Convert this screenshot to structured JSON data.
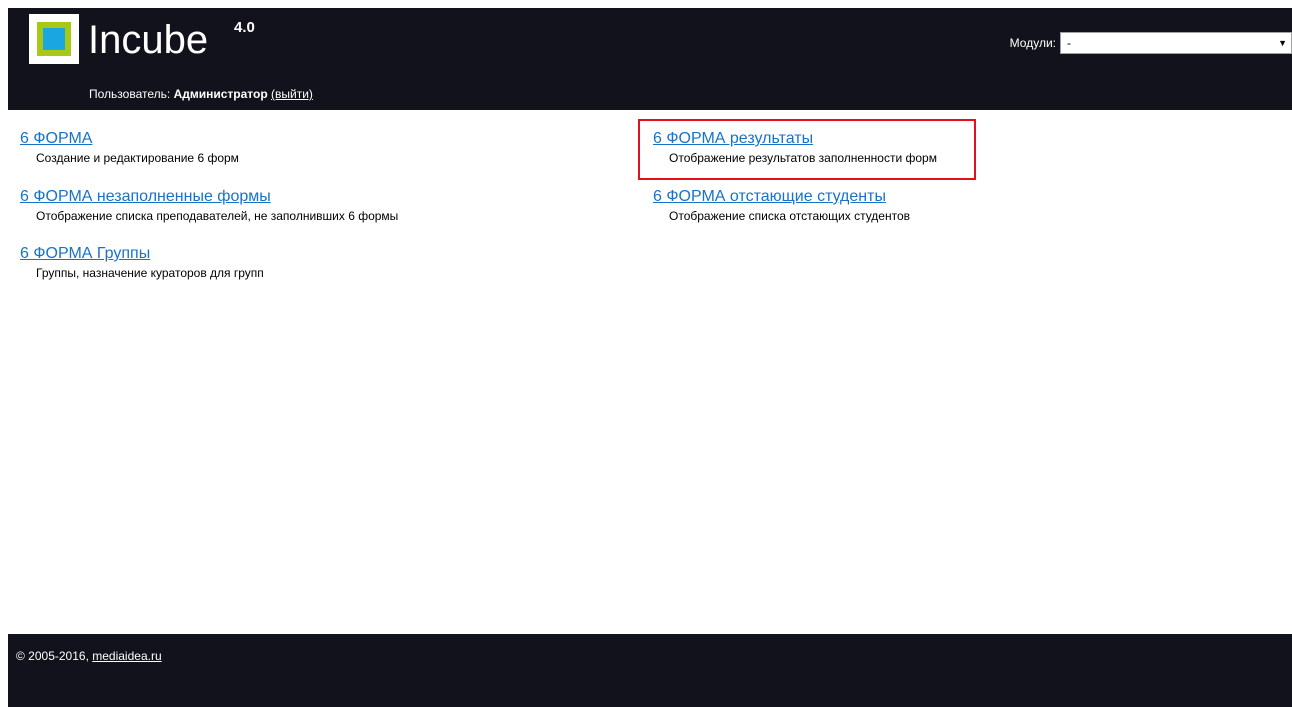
{
  "header": {
    "logo_text": "Incube",
    "version": "4.0",
    "user_label": "Пользователь:",
    "user_name": "Администратор",
    "logout_label": "(выйти)",
    "modules_label": "Модули:",
    "modules_selected": "-"
  },
  "items": [
    {
      "title": "6 ФОРМА",
      "description": "Создание и редактирование 6 форм"
    },
    {
      "title": "6 ФОРМА незаполненные формы",
      "description": "Отображение списка преподавателей, не заполнивших 6 формы"
    },
    {
      "title": "6 ФОРМА Группы",
      "description": "Группы, назначение кураторов для групп"
    },
    {
      "title": "6 ФОРМА результаты",
      "description": "Отображение результатов заполненности форм"
    },
    {
      "title": "6 ФОРМА отстающие студенты",
      "description": "Отображение списка отстающих студентов"
    }
  ],
  "footer": {
    "copyright": "© 2005-2016,",
    "link": "mediaidea.ru"
  },
  "colors": {
    "header_bg": "#12121c",
    "link": "#1773c9",
    "highlight": "#e3101b",
    "logo_green": "#a8c817",
    "logo_blue": "#1aa6e0"
  }
}
